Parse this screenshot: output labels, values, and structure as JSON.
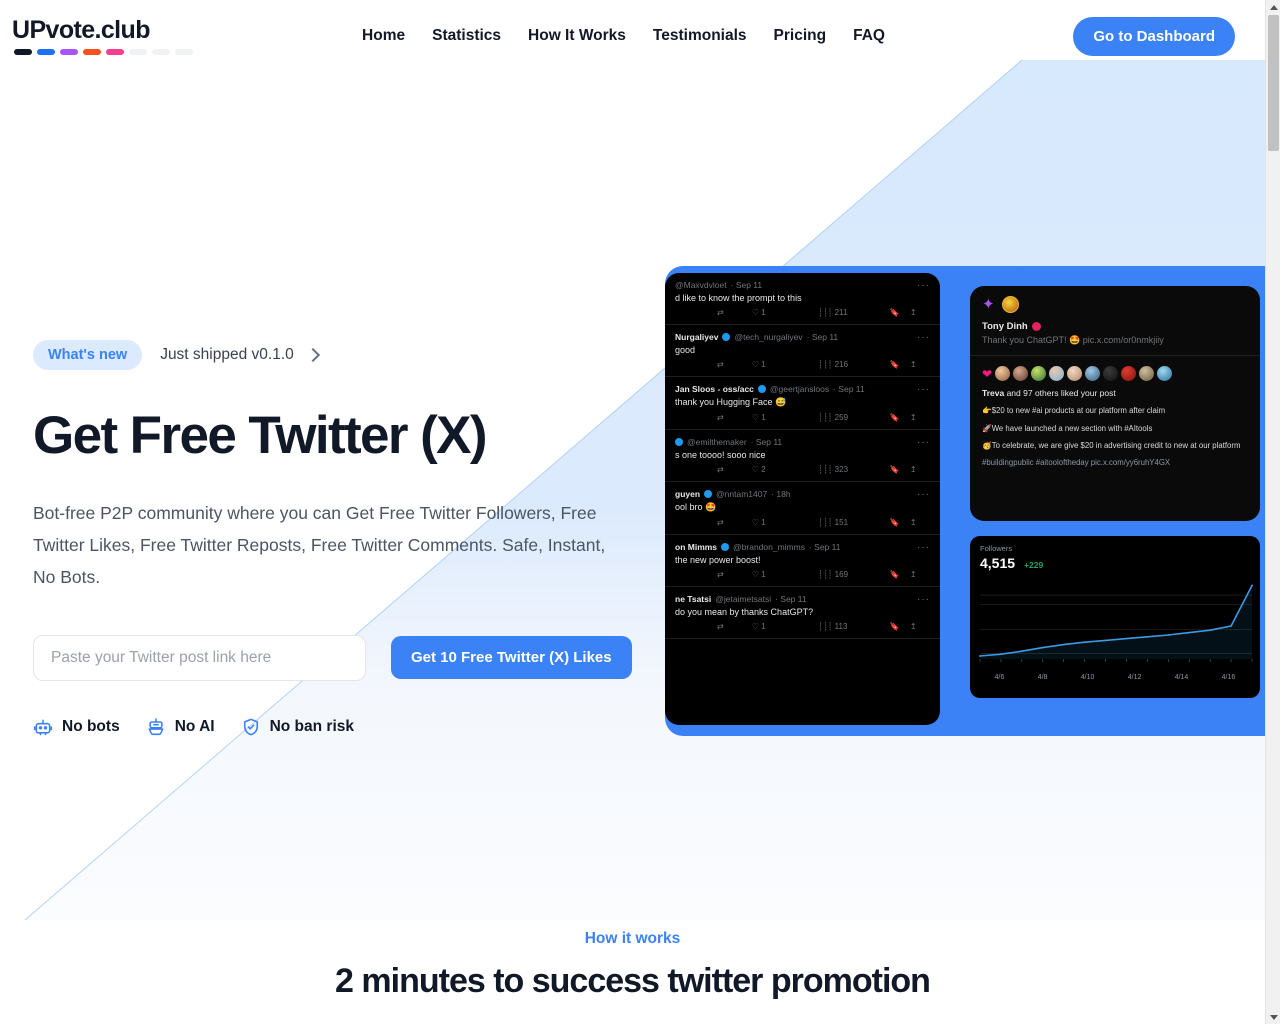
{
  "header": {
    "logo_text": "UPvote.club",
    "logo_dash_colors": [
      "#111827",
      "#1d72f3",
      "#a855f7",
      "#f4511e",
      "#f43f8e",
      "#f1f2f4",
      "#f1f2f4",
      "#f1f2f4"
    ],
    "nav_items": [
      {
        "label": "Home"
      },
      {
        "label": "Statistics"
      },
      {
        "label": "How It Works"
      },
      {
        "label": "Testimonials"
      },
      {
        "label": "Pricing"
      },
      {
        "label": "FAQ"
      }
    ],
    "cta_label": "Go to Dashboard"
  },
  "hero": {
    "badge_label": "What's new",
    "shipped_label": "Just shipped v0.1.0",
    "title": "Get Free Twitter (X)",
    "subtitle": "Bot-free P2P community where you can Get Free Twitter Followers, Free Twitter Likes, Free Twitter Reposts, Free Twitter Comments. Safe, Instant, No Bots.",
    "input_placeholder": "Paste your Twitter post link here",
    "input_value": "",
    "submit_label": "Get 10 Free Twitter (X) Likes",
    "trust": [
      {
        "icon": "robot-icon",
        "label": "No bots"
      },
      {
        "icon": "ai-icon",
        "label": "No AI"
      },
      {
        "icon": "shield-check-icon",
        "label": "No ban risk"
      }
    ]
  },
  "visual": {
    "accent_color": "#3b82f6",
    "tweets": [
      {
        "name": "",
        "verified": false,
        "handle": "@Maxvdvloet",
        "date": "Sep 11",
        "body": "d like to know the prompt to this",
        "reposts": "",
        "likes": "1",
        "views": "211"
      },
      {
        "name": "Nurgaliyev",
        "verified": true,
        "handle": "@tech_nurgaliyev",
        "date": "Sep 11",
        "body": "good",
        "reposts": "",
        "likes": "1",
        "views": "216"
      },
      {
        "name": "Jan Sloos - oss/acc",
        "verified": true,
        "handle": "@geertjansloos",
        "date": "Sep 11",
        "body": "thank you Hugging Face 😅",
        "reposts": "",
        "likes": "1",
        "views": "259"
      },
      {
        "name": "",
        "verified": true,
        "handle": "@emilthemaker",
        "date": "Sep 11",
        "body": "s one toooo! sooo nice",
        "reposts": "",
        "likes": "2",
        "views": "323"
      },
      {
        "name": "guyen",
        "verified": true,
        "handle": "@nntam1407",
        "date": "18h",
        "body": "ool bro 🤩",
        "reposts": "",
        "likes": "1",
        "views": "151"
      },
      {
        "name": "on Mimms",
        "verified": true,
        "handle": "@brandon_mimms",
        "date": "Sep 11",
        "body": "the new power boost!",
        "reposts": "",
        "likes": "1",
        "views": "169"
      },
      {
        "name": "ne Tsatsi",
        "verified": false,
        "handle": "@jetaimetsatsi",
        "date": "Sep 11",
        "body": "do you mean by thanks ChatGPT?",
        "reposts": "",
        "likes": "1",
        "views": "113"
      }
    ],
    "notification": {
      "author": "Tony Dinh",
      "post_text": "Thank you ChatGPT! 🤩 pic.x.com/or0nmkjiiy",
      "liked_prefix": "Treva",
      "liked_rest": " and 97 others liked your post",
      "lines": [
        "👉$20 to new #ai products at our platform after claim",
        "🚀We have launched a new section with #AItools",
        "🥳To celebrate, we are give $20 in advertising credit to new at our platform"
      ],
      "tags": "#buildingpublic #aitooloftheday pic.x.com/yy6ruhY4GX"
    },
    "chart_data": {
      "type": "line",
      "title": "Followers",
      "value": "4,515",
      "delta": "+229",
      "delta_color": "#21a366",
      "line_color": "#3b9ae1",
      "xlabel": "",
      "ylabel": "",
      "categories": [
        "4/6",
        "4/8",
        "4/10",
        "4/12",
        "4/14",
        "4/16"
      ],
      "x": [
        0,
        1,
        2,
        3,
        4,
        5,
        6,
        7,
        8,
        9,
        10,
        11,
        12,
        13
      ],
      "values": [
        4280,
        4286,
        4296,
        4308,
        4318,
        4326,
        4332,
        4338,
        4344,
        4350,
        4358,
        4366,
        4380,
        4515
      ],
      "ylim": [
        4270,
        4530
      ],
      "grid": true,
      "legend": "none"
    }
  },
  "how_it_works": {
    "eyebrow": "How it works",
    "title": "2 minutes to success twitter promotion"
  }
}
